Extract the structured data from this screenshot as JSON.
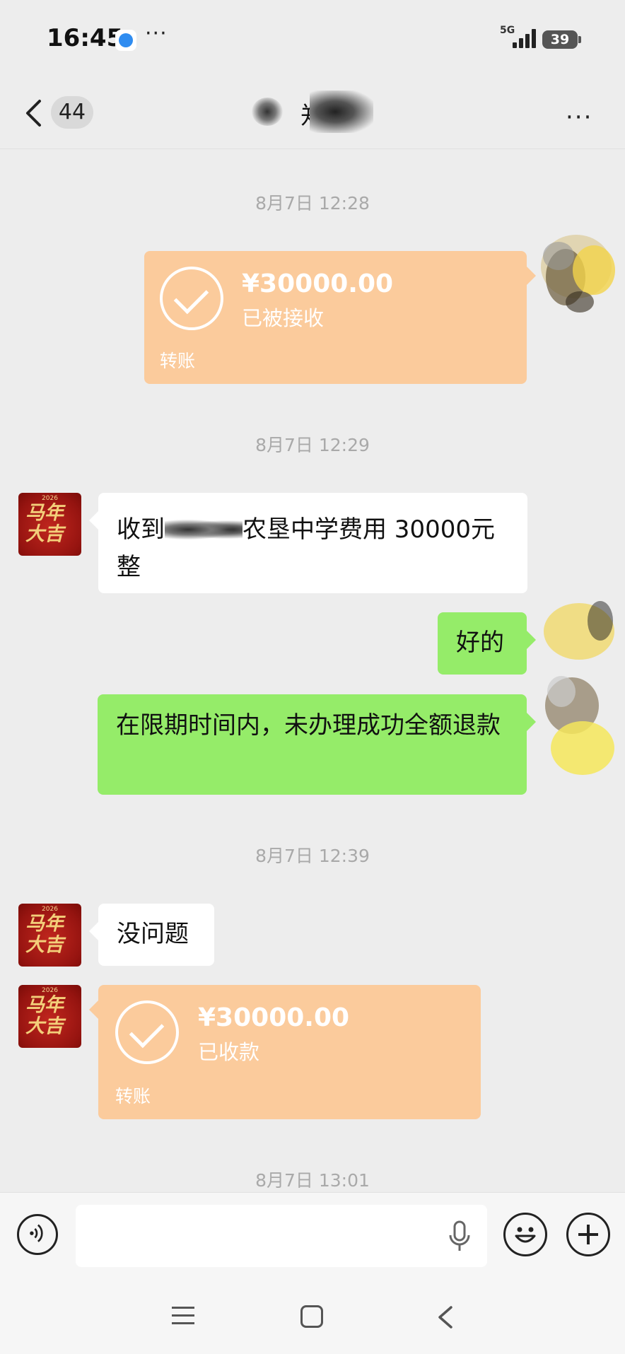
{
  "status_bar": {
    "time": "16:45",
    "more": "···",
    "network": "5G",
    "battery": "39"
  },
  "header": {
    "unread_count": "44",
    "title": "郑",
    "menu": "···"
  },
  "messages": {
    "ts1": "8月7日 12:28",
    "transfer1": {
      "amount": "¥30000.00",
      "status": "已被接收",
      "kind": "转账"
    },
    "ts2": "8月7日 12:29",
    "msg1": {
      "before": "收到",
      "after": "农垦中学费用 30000元整"
    },
    "msg2": "好的",
    "msg3": "在限期时间内，未办理成功全额退款",
    "ts3": "8月7日 12:39",
    "msg4": "没问题",
    "transfer2": {
      "amount": "¥30000.00",
      "status": "已收款",
      "kind": "转账"
    },
    "ts4": "8月7日 13:01"
  },
  "avatar": {
    "year": "2026",
    "glyph": "马年 大吉"
  },
  "input": {
    "value": "",
    "placeholder": ""
  },
  "colors": {
    "background": "#ededed",
    "transfer": "#fbcb9c",
    "outgoing_bubble": "#95ec69",
    "incoming_bubble": "#ffffff",
    "avatar": "#961410"
  },
  "icons": [
    "back-chevron-icon",
    "more-icon",
    "voice-icon",
    "mic-icon",
    "emoji-icon",
    "plus-icon",
    "nav-menu-icon",
    "nav-home-icon",
    "nav-back-icon"
  ]
}
